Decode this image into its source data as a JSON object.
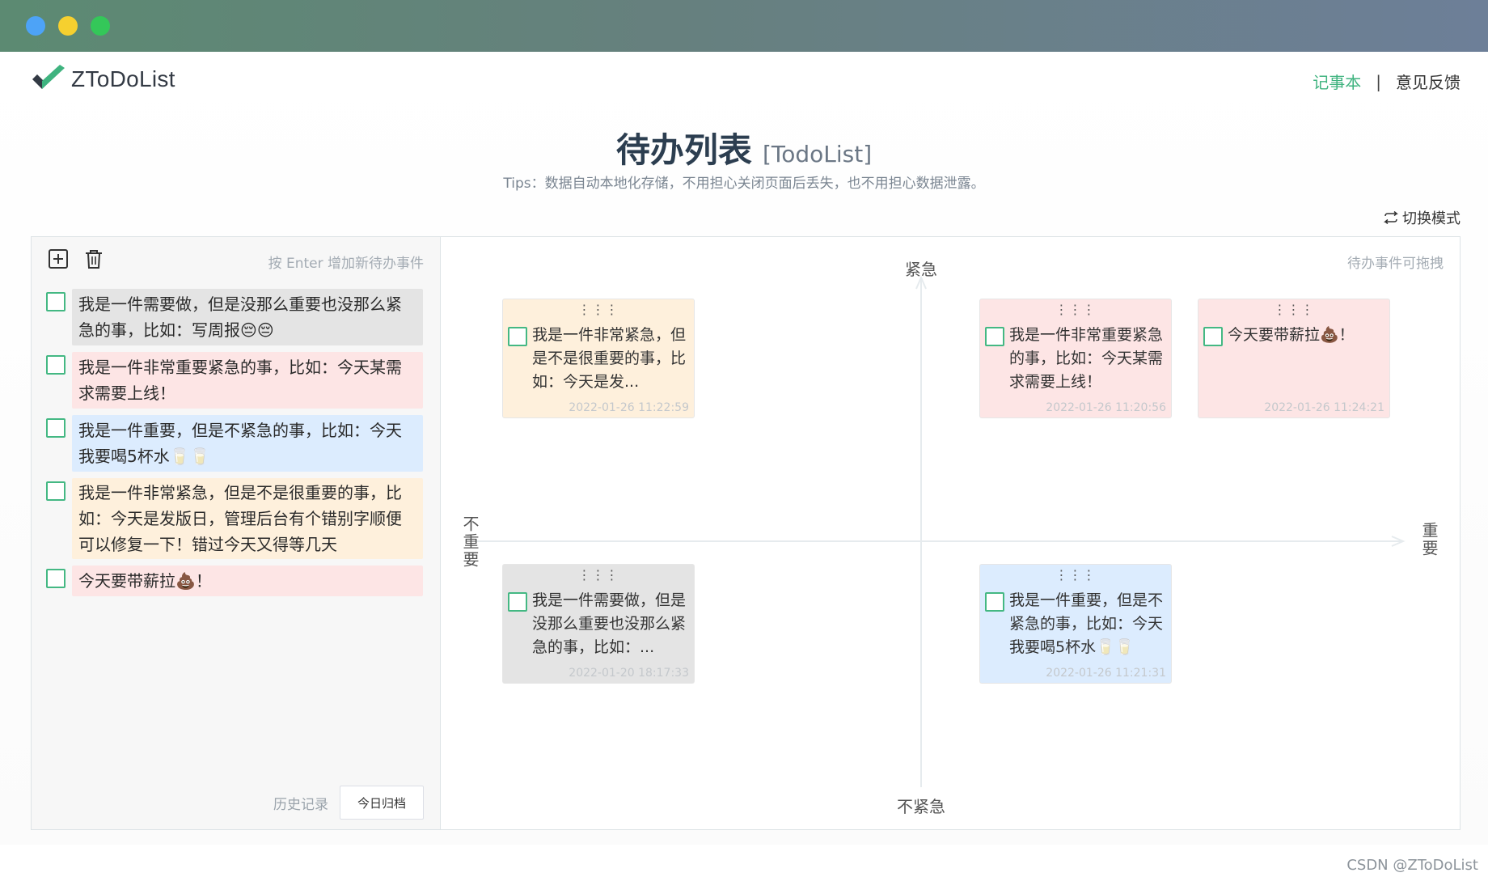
{
  "app": {
    "name": "ZToDoList"
  },
  "nav": {
    "notebook": "记事本",
    "separator": "|",
    "feedback": "意见反馈"
  },
  "header": {
    "title": "待办列表",
    "subtitle": "[TodoList]",
    "tips": "Tips：数据自动本地化存储，不用担心关闭页面后丢失，也不用担心数据泄露。"
  },
  "switch_mode": {
    "label": "切换模式"
  },
  "left_panel": {
    "input_hint": "按 Enter 增加新待办事件",
    "items": [
      {
        "text": "我是一件需要做，但是没那么重要也没那么紧急的事，比如：写周报😔😔",
        "category": "gray"
      },
      {
        "text": "我是一件非常重要紧急的事，比如：今天某需求需要上线！",
        "category": "red"
      },
      {
        "text": "我是一件重要，但是不紧急的事，比如：今天我要喝5杯水🥛🥛",
        "category": "blue"
      },
      {
        "text": "我是一件非常紧急，但是不是很重要的事，比如：今天是发版日，管理后台有个错别字顺便可以修复一下！错过今天又得等几天",
        "category": "orange"
      },
      {
        "text": "今天要带薪拉💩！",
        "category": "red"
      }
    ],
    "footer": {
      "history": "历史记录",
      "archive": "今日归档"
    }
  },
  "quadrant": {
    "drag_hint": "待办事件可拖拽",
    "axis": {
      "top": "紧急",
      "bottom": "不紧急",
      "left": "不重要",
      "right": "重要"
    },
    "cards": [
      {
        "text": "我是一件非常紧急，但是不是很重要的事，比如：今天是发...",
        "time": "2022-01-26 11:22:59",
        "color": "#fef0dc"
      },
      {
        "text": "我是一件非常重要紧急的事，比如：今天某需求需要上线！",
        "time": "2022-01-26 11:20:56",
        "color": "#fde5e5"
      },
      {
        "text": "今天要带薪拉💩！",
        "time": "2022-01-26 11:24:21",
        "color": "#fde5e5"
      },
      {
        "text": "我是一件需要做，但是没那么重要也没那么紧急的事，比如：...",
        "time": "2022-01-20 18:17:33",
        "color": "#e4e4e4"
      },
      {
        "text": "我是一件重要，但是不紧急的事，比如：今天我要喝5杯水🥛🥛",
        "time": "2022-01-26 11:21:31",
        "color": "#dcecfe"
      }
    ]
  },
  "colors": {
    "accent": "#3fb37f",
    "checkbox": "#44b883"
  },
  "watermark": "CSDN @ZToDoList"
}
